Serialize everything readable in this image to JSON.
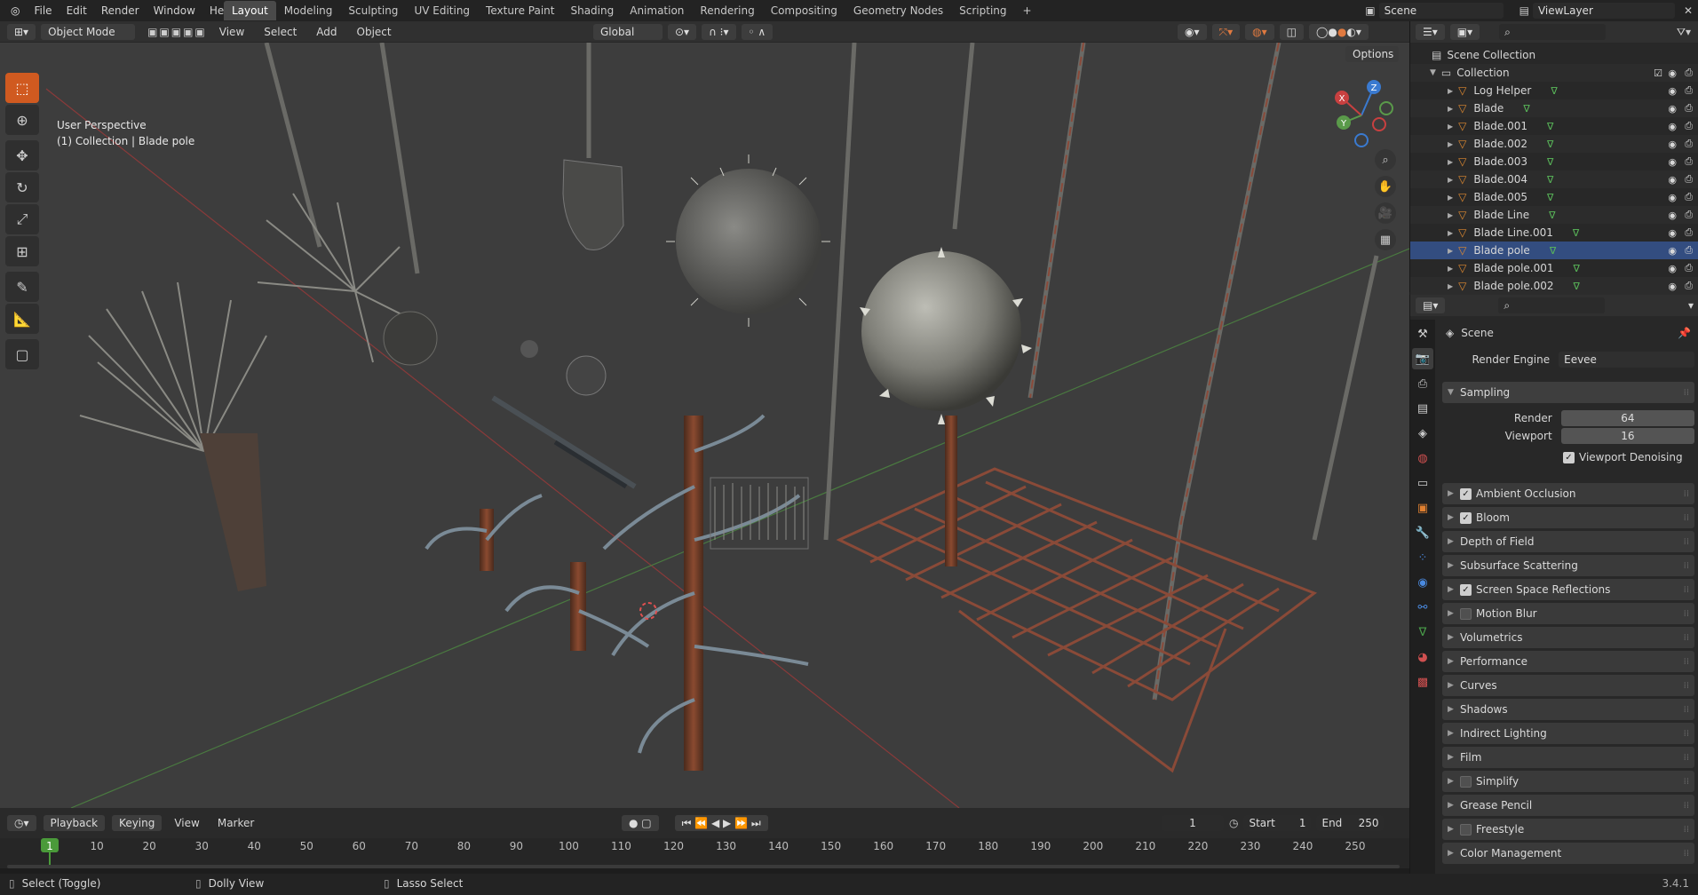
{
  "topbar": {
    "menus": [
      "File",
      "Edit",
      "Render",
      "Window",
      "Help"
    ],
    "workspaces": [
      "Layout",
      "Modeling",
      "Sculpting",
      "UV Editing",
      "Texture Paint",
      "Shading",
      "Animation",
      "Rendering",
      "Compositing",
      "Geometry Nodes",
      "Scripting"
    ],
    "active_workspace": "Layout",
    "add_tab": "+",
    "scene": "Scene",
    "viewlayer": "ViewLayer"
  },
  "viewport_header": {
    "mode": "Object Mode",
    "menus": [
      "View",
      "Select",
      "Add",
      "Object"
    ],
    "orientation": "Global",
    "options": "Options"
  },
  "viewport": {
    "perspective": "User Perspective",
    "context": "(1) Collection | Blade pole",
    "gizmo": {
      "x": "X",
      "y": "Y",
      "z": "Z"
    }
  },
  "outliner": {
    "root": "Scene Collection",
    "collection": "Collection",
    "items": [
      "Log Helper",
      "Blade",
      "Blade.001",
      "Blade.002",
      "Blade.003",
      "Blade.004",
      "Blade.005",
      "Blade Line",
      "Blade Line.001",
      "Blade pole",
      "Blade pole.001",
      "Blade pole.002"
    ],
    "selected": "Blade pole"
  },
  "properties": {
    "context": "Scene",
    "render_engine_label": "Render Engine",
    "render_engine": "Eevee",
    "sampling": {
      "title": "Sampling",
      "render_label": "Render",
      "render": "64",
      "viewport_label": "Viewport",
      "viewport": "16",
      "denoise": "Viewport Denoising"
    },
    "panels": [
      {
        "label": "Ambient Occlusion",
        "check": "on"
      },
      {
        "label": "Bloom",
        "check": "on"
      },
      {
        "label": "Depth of Field",
        "check": "none"
      },
      {
        "label": "Subsurface Scattering",
        "check": "none"
      },
      {
        "label": "Screen Space Reflections",
        "check": "on"
      },
      {
        "label": "Motion Blur",
        "check": "off"
      },
      {
        "label": "Volumetrics",
        "check": "none"
      },
      {
        "label": "Performance",
        "check": "none"
      },
      {
        "label": "Curves",
        "check": "none"
      },
      {
        "label": "Shadows",
        "check": "none"
      },
      {
        "label": "Indirect Lighting",
        "check": "none"
      },
      {
        "label": "Film",
        "check": "none"
      },
      {
        "label": "Simplify",
        "check": "off"
      },
      {
        "label": "Grease Pencil",
        "check": "none"
      },
      {
        "label": "Freestyle",
        "check": "off"
      },
      {
        "label": "Color Management",
        "check": "none"
      }
    ]
  },
  "timeline": {
    "playback": "Playback",
    "keying": "Keying",
    "view": "View",
    "marker": "Marker",
    "current_frame": "1",
    "start_label": "Start",
    "start": "1",
    "end_label": "End",
    "end": "250",
    "ruler": [
      "1",
      "10",
      "20",
      "30",
      "40",
      "50",
      "60",
      "70",
      "80",
      "90",
      "100",
      "110",
      "120",
      "130",
      "140",
      "150",
      "160",
      "170",
      "180",
      "190",
      "200",
      "210",
      "220",
      "230",
      "240",
      "250"
    ]
  },
  "status": {
    "select": "Select (Toggle)",
    "dolly": "Dolly View",
    "lasso": "Lasso Select",
    "version": "3.4.1"
  },
  "colors": {
    "accent": "#d05a20",
    "selection": "#334d80",
    "x_axis": "#c84040",
    "y_axis": "#5a9a4a",
    "z_axis": "#3a7ad0"
  }
}
